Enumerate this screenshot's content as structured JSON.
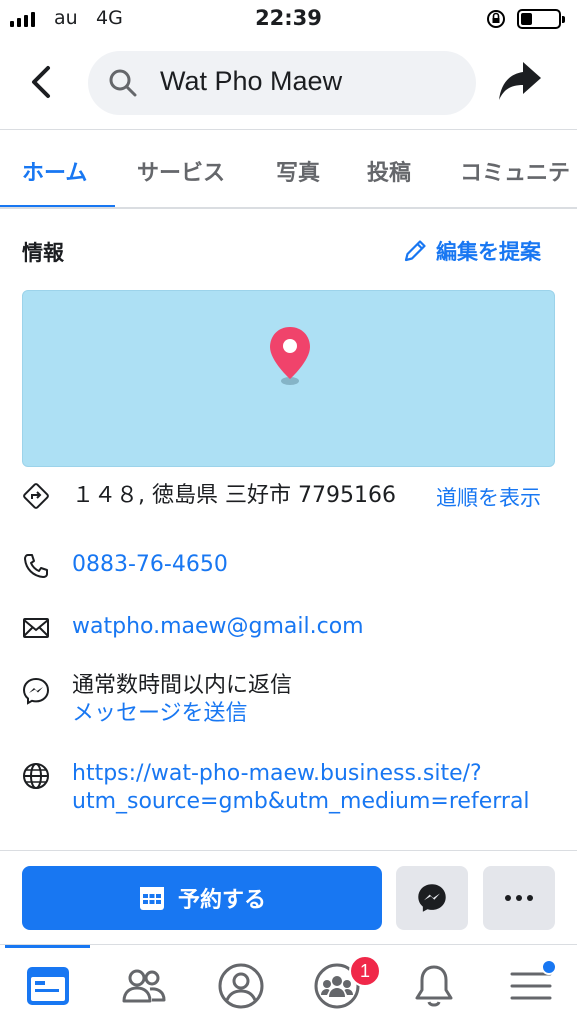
{
  "status_bar": {
    "carrier": "au",
    "network": "4G",
    "time": "22:39"
  },
  "header": {
    "search_text": "Wat Pho Maew"
  },
  "tabs": [
    {
      "label": "ホーム",
      "active": true
    },
    {
      "label": "サービス",
      "active": false
    },
    {
      "label": "写真",
      "active": false
    },
    {
      "label": "投稿",
      "active": false
    },
    {
      "label": "コミュニテ",
      "active": false
    }
  ],
  "info": {
    "title": "情報",
    "suggest_edit": "編集を提案",
    "address": "１４８, 徳島県 三好市 7795166",
    "directions": "道順を表示",
    "phone": "0883-76-4650",
    "email": "watpho.maew@gmail.com",
    "response_time": "通常数時間以内に返信",
    "send_message": "メッセージを送信",
    "website_line1": "https://wat-pho-maew.business.site/?",
    "website_line2": "utm_source=gmb&utm_medium=referral"
  },
  "actions": {
    "reserve_label": "予約する"
  },
  "bottom_nav": {
    "notification_badge": "1"
  },
  "colors": {
    "accent": "#1877f2",
    "map": "#ade0f4",
    "pin": "#f0436b",
    "badge": "#f02849"
  }
}
